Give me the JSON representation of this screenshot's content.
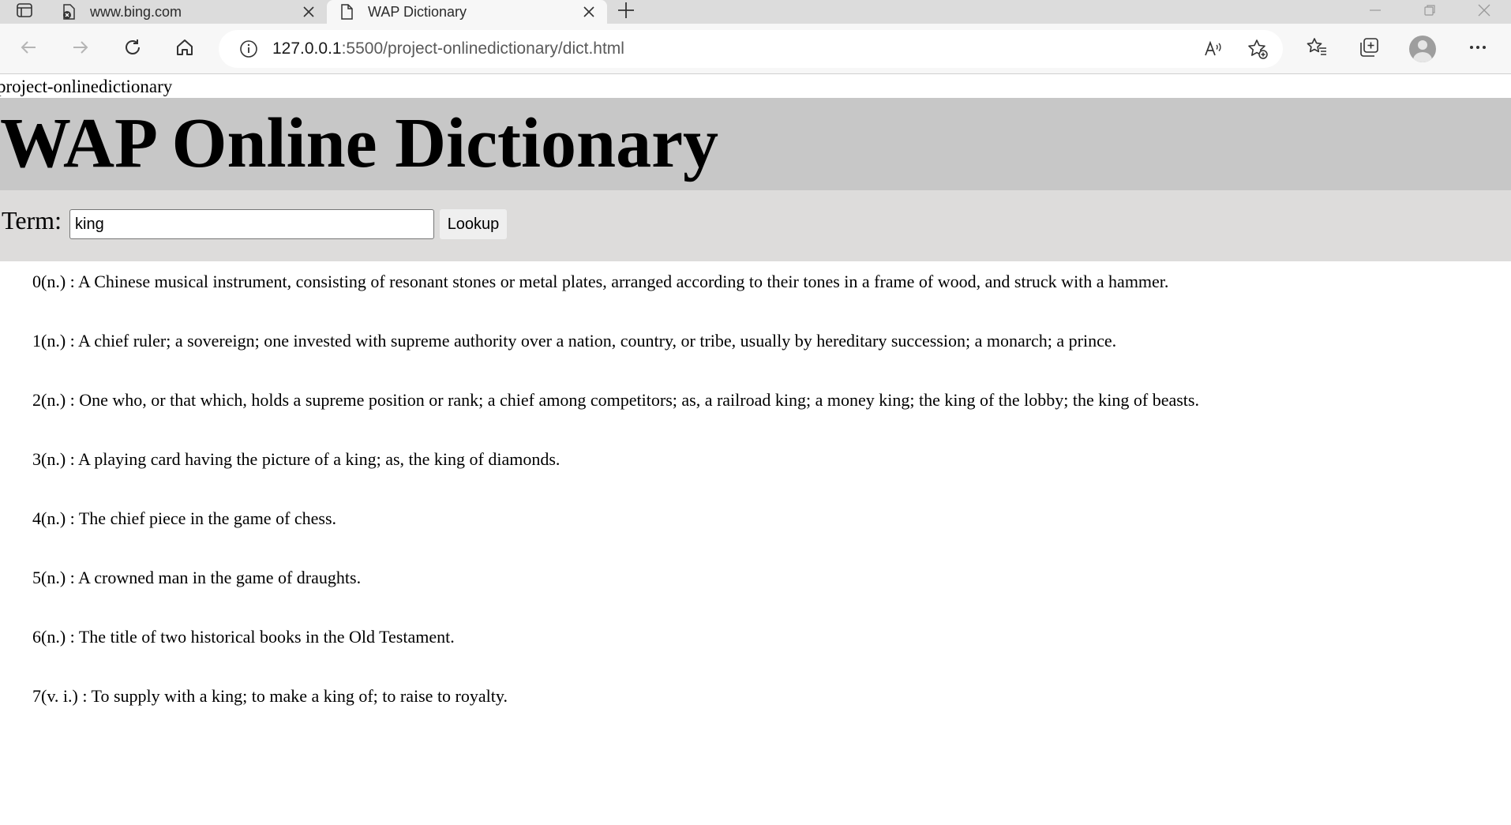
{
  "browser": {
    "tabs": [
      {
        "title": "www.bing.com",
        "icon": "globe-error-icon",
        "active": false
      },
      {
        "title": "WAP Dictionary",
        "icon": "page-icon",
        "active": true
      }
    ],
    "url": {
      "host": "127.0.0.1",
      "rest": ":5500/project-onlinedictionary/dict.html"
    }
  },
  "page": {
    "site_label": "project-onlinedictionary",
    "title": "WAP Online Dictionary",
    "search": {
      "label": "Term:",
      "value": "king",
      "button_label": "Lookup"
    },
    "definitions": [
      "0(n.) : A Chinese musical instrument, consisting of resonant stones or metal plates, arranged according to their tones in a frame of wood, and struck with a hammer.",
      "1(n.) : A chief ruler; a sovereign; one invested with supreme authority over a nation, country, or tribe, usually by hereditary succession; a monarch; a prince.",
      "2(n.) : One who, or that which, holds a supreme position or rank; a chief among competitors; as, a railroad king; a money king; the king of the lobby; the king of beasts.",
      "3(n.) : A playing card having the picture of a king; as, the king of diamonds.",
      "4(n.) : The chief piece in the game of chess.",
      "5(n.) : A crowned man in the game of draughts.",
      "6(n.) : The title of two historical books in the Old Testament.",
      "7(v. i.) : To supply with a king; to make a king of; to raise to royalty."
    ]
  }
}
